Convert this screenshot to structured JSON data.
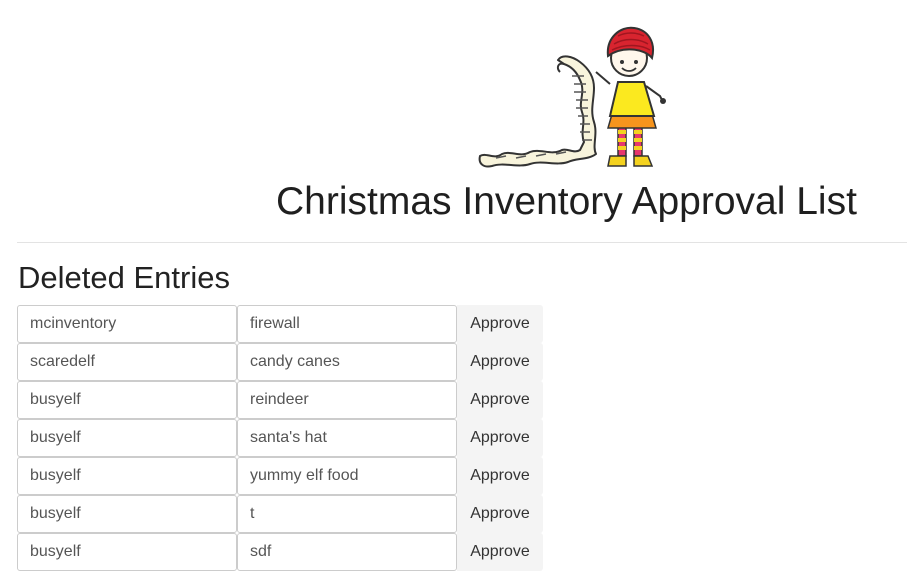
{
  "header": {
    "title": "Christmas Inventory Approval List",
    "illustration": "elf-with-scroll-illustration"
  },
  "section": {
    "heading": "Deleted Entries"
  },
  "entries": [
    {
      "user": "mcinventory",
      "item": "firewall",
      "action": "Approve"
    },
    {
      "user": "scaredelf",
      "item": "candy canes",
      "action": "Approve"
    },
    {
      "user": "busyelf",
      "item": "reindeer",
      "action": "Approve"
    },
    {
      "user": "busyelf",
      "item": "santa's hat",
      "action": "Approve"
    },
    {
      "user": "busyelf",
      "item": "yummy elf food",
      "action": "Approve"
    },
    {
      "user": "busyelf",
      "item": "t",
      "action": "Approve"
    },
    {
      "user": "busyelf",
      "item": "sdf",
      "action": "Approve"
    }
  ]
}
